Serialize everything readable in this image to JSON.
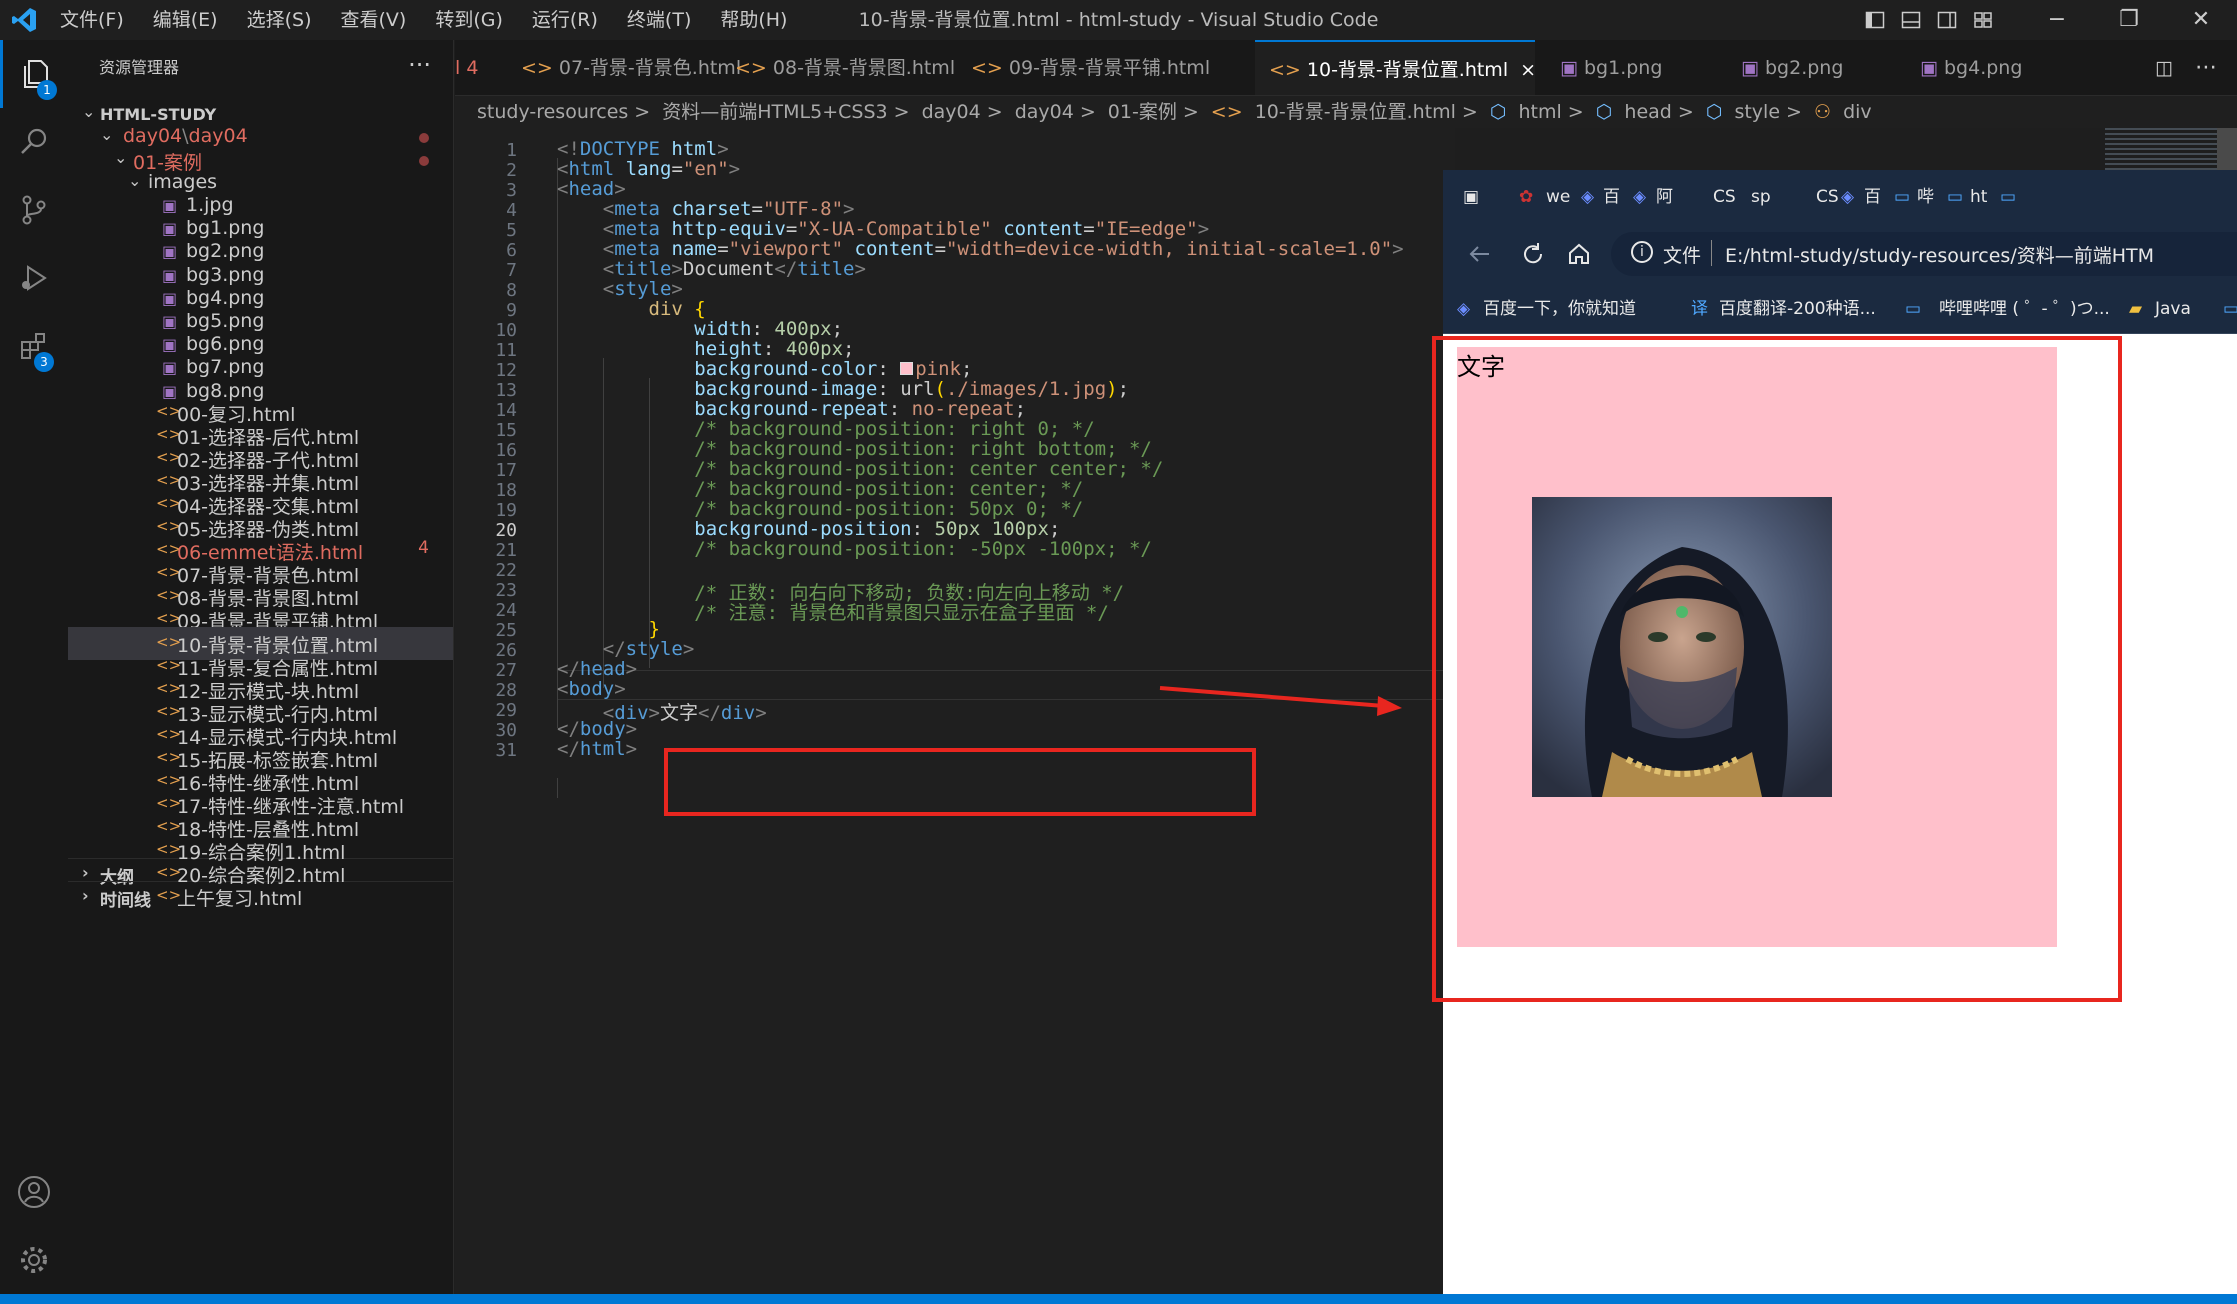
{
  "window": {
    "title": "10-背景-背景位置.html - html-study - Visual Studio Code",
    "menus": [
      "文件(F)",
      "编辑(E)",
      "选择(S)",
      "查看(V)",
      "转到(G)",
      "运行(R)",
      "终端(T)",
      "帮助(H)"
    ]
  },
  "activity_bar": {
    "explorer_badge": "1",
    "extensions_badge": "3"
  },
  "sidebar": {
    "header": "资源管理器",
    "more": "···",
    "root": "HTML-STUDY",
    "folder_day04": "day04",
    "folder_day04_sep": "\\",
    "folder_day04_b": "day04",
    "folder_cases": "01-案例",
    "folder_images": "images",
    "images": [
      "1.jpg",
      "bg1.png",
      "bg2.png",
      "bg3.png",
      "bg4.png",
      "bg5.png",
      "bg6.png",
      "bg7.png",
      "bg8.png"
    ],
    "files": [
      "00-复习.html",
      "01-选择器-后代.html",
      "02-选择器-子代.html",
      "03-选择器-并集.html",
      "04-选择器-交集.html",
      "05-选择器-伪类.html",
      "06-emmet语法.html",
      "07-背景-背景色.html",
      "08-背景-背景图.html",
      "09-背景-背景平铺.html",
      "10-背景-背景位置.html",
      "11-背景-复合属性.html",
      "12-显示模式-块.html",
      "13-显示模式-行内.html",
      "14-显示模式-行内块.html",
      "15-拓展-标签嵌套.html",
      "16-特性-继承性.html",
      "17-特性-继承性-注意.html",
      "18-特性-层叠性.html",
      "19-综合案例1.html",
      "20-综合案例2.html",
      "上午复习.html"
    ],
    "emmet_count": "4",
    "outline": "大纲",
    "timeline": "时间线"
  },
  "tabs": {
    "partial": "l 4",
    "items": [
      "07-背景-背景色.html",
      "08-背景-背景图.html",
      "09-背景-背景平铺.html",
      "10-背景-背景位置.html",
      "bg1.png",
      "bg2.png",
      "bg4.png"
    ],
    "close": "×"
  },
  "breadcrumb": {
    "items": [
      "study-resources",
      "资料—前端HTML5+CSS3",
      "day04",
      "day04",
      "01-案例",
      "10-背景-背景位置.html",
      "html",
      "head",
      "style",
      "div"
    ],
    "sep": ">"
  },
  "editor": {
    "current_line": 20,
    "lines": [
      [
        [
          "p",
          "<!"
        ],
        [
          "t",
          "DOCTYPE"
        ],
        [
          "w",
          " "
        ],
        [
          "a",
          "html"
        ],
        [
          "p",
          ">"
        ]
      ],
      [
        [
          "p",
          "<"
        ],
        [
          "t",
          "html"
        ],
        [
          "w",
          " "
        ],
        [
          "a",
          "lang"
        ],
        [
          "w",
          "="
        ],
        [
          "s",
          "\"en\""
        ],
        [
          "p",
          ">"
        ]
      ],
      [
        [
          "p",
          "<"
        ],
        [
          "t",
          "head"
        ],
        [
          "p",
          ">"
        ]
      ],
      [
        [
          "w",
          "    "
        ],
        [
          "p",
          "<"
        ],
        [
          "t",
          "meta"
        ],
        [
          "w",
          " "
        ],
        [
          "a",
          "charset"
        ],
        [
          "w",
          "="
        ],
        [
          "s",
          "\"UTF-8\""
        ],
        [
          "p",
          ">"
        ]
      ],
      [
        [
          "w",
          "    "
        ],
        [
          "p",
          "<"
        ],
        [
          "t",
          "meta"
        ],
        [
          "w",
          " "
        ],
        [
          "a",
          "http-equiv"
        ],
        [
          "w",
          "="
        ],
        [
          "s",
          "\"X-UA-Compatible\""
        ],
        [
          "w",
          " "
        ],
        [
          "a",
          "content"
        ],
        [
          "w",
          "="
        ],
        [
          "s",
          "\"IE=edge\""
        ],
        [
          "p",
          ">"
        ]
      ],
      [
        [
          "w",
          "    "
        ],
        [
          "p",
          "<"
        ],
        [
          "t",
          "meta"
        ],
        [
          "w",
          " "
        ],
        [
          "a",
          "name"
        ],
        [
          "w",
          "="
        ],
        [
          "s",
          "\"viewport\""
        ],
        [
          "w",
          " "
        ],
        [
          "a",
          "content"
        ],
        [
          "w",
          "="
        ],
        [
          "s",
          "\"width=device-width, initial-scale=1.0\""
        ],
        [
          "p",
          ">"
        ]
      ],
      [
        [
          "w",
          "    "
        ],
        [
          "p",
          "<"
        ],
        [
          "t",
          "title"
        ],
        [
          "p",
          ">"
        ],
        [
          "w",
          "Document"
        ],
        [
          "p",
          "</"
        ],
        [
          "t",
          "title"
        ],
        [
          "p",
          ">"
        ]
      ],
      [
        [
          "w",
          "    "
        ],
        [
          "p",
          "<"
        ],
        [
          "t",
          "style"
        ],
        [
          "p",
          ">"
        ]
      ],
      [
        [
          "w",
          "        "
        ],
        [
          "k",
          "div"
        ],
        [
          "w",
          " "
        ],
        [
          "y",
          "{"
        ]
      ],
      [
        [
          "w",
          "            "
        ],
        [
          "a",
          "width"
        ],
        [
          "w",
          ": "
        ],
        [
          "v",
          "400px"
        ],
        [
          "w",
          ";"
        ]
      ],
      [
        [
          "w",
          "            "
        ],
        [
          "a",
          "height"
        ],
        [
          "w",
          ": "
        ],
        [
          "v",
          "400px"
        ],
        [
          "w",
          ";"
        ]
      ],
      [
        [
          "w",
          "            "
        ],
        [
          "a",
          "background-color"
        ],
        [
          "w",
          ": "
        ],
        [
          "sw",
          ""
        ],
        [
          "s",
          "pink"
        ],
        [
          "w",
          ";"
        ]
      ],
      [
        [
          "w",
          "            "
        ],
        [
          "a",
          "background-image"
        ],
        [
          "w",
          ": "
        ],
        [
          "w",
          "url"
        ],
        [
          "y",
          "("
        ],
        [
          "s",
          "./images/1.jpg"
        ],
        [
          "y",
          ")"
        ],
        [
          "w",
          ";"
        ]
      ],
      [
        [
          "w",
          "            "
        ],
        [
          "a",
          "background-repeat"
        ],
        [
          "w",
          ": "
        ],
        [
          "s",
          "no-repeat"
        ],
        [
          "w",
          ";"
        ]
      ],
      [
        [
          "w",
          "            "
        ],
        [
          "c",
          "/* background-position: right 0; */"
        ]
      ],
      [
        [
          "w",
          "            "
        ],
        [
          "c",
          "/* background-position: right bottom; */"
        ]
      ],
      [
        [
          "w",
          "            "
        ],
        [
          "c",
          "/* background-position: center center; */"
        ]
      ],
      [
        [
          "w",
          "            "
        ],
        [
          "c",
          "/* background-position: center; */"
        ]
      ],
      [
        [
          "w",
          "            "
        ],
        [
          "c",
          "/* background-position: 50px 0; */"
        ]
      ],
      [
        [
          "w",
          "            "
        ],
        [
          "a",
          "background-position"
        ],
        [
          "w",
          ": "
        ],
        [
          "v",
          "50px"
        ],
        [
          "w",
          " "
        ],
        [
          "v",
          "100px"
        ],
        [
          "w",
          ";"
        ]
      ],
      [
        [
          "w",
          "            "
        ],
        [
          "c",
          "/* background-position: -50px -100px; */"
        ]
      ],
      [
        [
          "w",
          ""
        ]
      ],
      [
        [
          "w",
          "            "
        ],
        [
          "c",
          "/* 正数: 向右向下移动; 负数:向左向上移动 */"
        ]
      ],
      [
        [
          "w",
          "            "
        ],
        [
          "c",
          "/* 注意: 背景色和背景图只显示在盒子里面 */"
        ]
      ],
      [
        [
          "w",
          "        "
        ],
        [
          "y",
          "}"
        ]
      ],
      [
        [
          "w",
          "    "
        ],
        [
          "p",
          "</"
        ],
        [
          "t",
          "style"
        ],
        [
          "p",
          ">"
        ]
      ],
      [
        [
          "p",
          "</"
        ],
        [
          "t",
          "head"
        ],
        [
          "p",
          ">"
        ]
      ],
      [
        [
          "p",
          "<"
        ],
        [
          "t",
          "body"
        ],
        [
          "p",
          ">"
        ]
      ],
      [
        [
          "w",
          "    "
        ],
        [
          "p",
          "<"
        ],
        [
          "t",
          "div"
        ],
        [
          "p",
          ">"
        ],
        [
          "w",
          "文字"
        ],
        [
          "p",
          "</"
        ],
        [
          "t",
          "div"
        ],
        [
          "p",
          ">"
        ]
      ],
      [
        [
          "p",
          "</"
        ],
        [
          "t",
          "body"
        ],
        [
          "p",
          ">"
        ]
      ],
      [
        [
          "p",
          "</"
        ],
        [
          "t",
          "html"
        ],
        [
          "p",
          ">"
        ]
      ]
    ]
  },
  "browser": {
    "tabs": [
      "we",
      "百",
      "阿",
      "CS",
      "sp",
      "CS",
      "百",
      "哔",
      "ht"
    ],
    "file_label": "文件",
    "address": "E:/html-study/study-resources/资料—前端HTM",
    "favorites": [
      "百度一下，你就知道",
      "百度翻译-200种语...",
      "哔哩哔哩 ( ゜- ゜)つ...",
      "Java"
    ],
    "page_text": "文字"
  },
  "colors": {
    "accent": "#0078d4",
    "pink": "#ffc0cb",
    "annotation_red": "#e8261f"
  }
}
